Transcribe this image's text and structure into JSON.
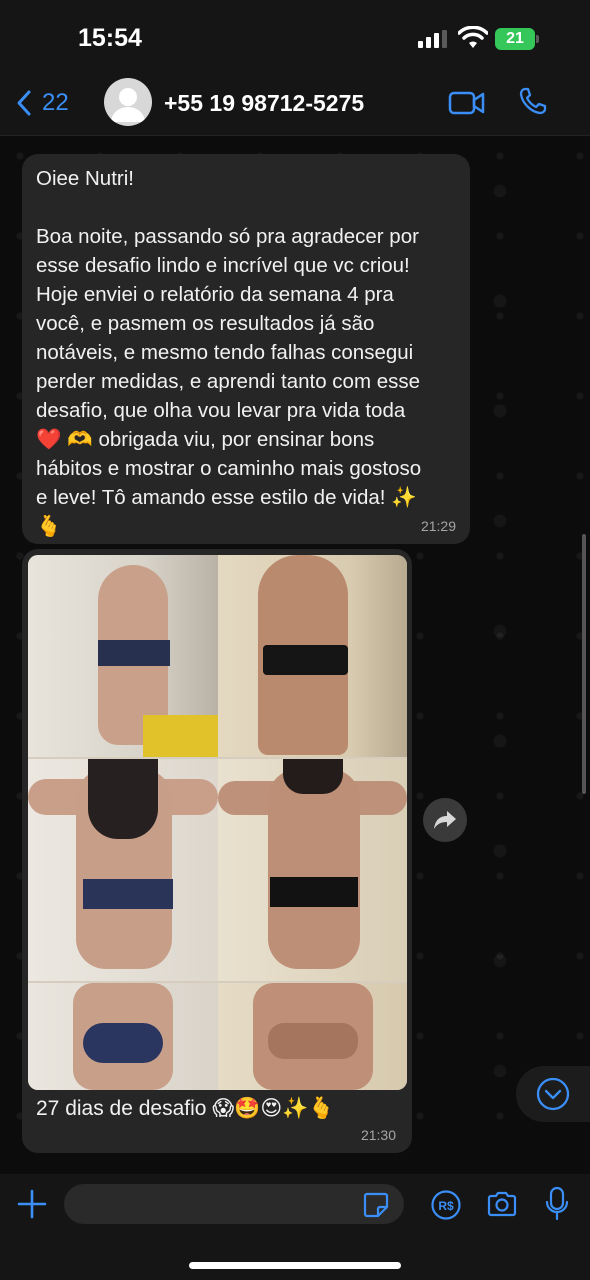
{
  "status_bar": {
    "time": "15:54",
    "battery": "21"
  },
  "header": {
    "back_count": "22",
    "contact": "+55 19 98712-5275",
    "icons": [
      "chevron-left-icon",
      "avatar",
      "video-icon",
      "phone-icon"
    ],
    "accent_color": "#3a8ef6"
  },
  "messages": [
    {
      "lines": [
        "Oiee Nutri!",
        "",
        "Boa noite, passando só pra agradecer por",
        "esse desafio lindo e incrível que vc criou!",
        "Hoje enviei o relatório da semana 4 pra",
        "você, e pasmem os resultados já são",
        "notáveis, e mesmo tendo falhas consegui",
        "perder medidas, e aprendi tanto com esse",
        "desafio, que olha vou levar pra vida toda",
        "❤️ 🫶 obrigada viu, por ensinar bons",
        "hábitos e mostrar o caminho mais gostoso",
        "e leve! Tô amando esse estilo de vida! ✨",
        "🫰"
      ],
      "time": "21:29"
    },
    {
      "caption": "27 dias de desafio 😱🤩😍✨🫰",
      "time": "21:30"
    }
  ],
  "input": {
    "placeholder": ""
  },
  "colors": {
    "bubble": "#262626",
    "background": "#0c0c0c",
    "bars": "#151515",
    "battery": "#35c759"
  }
}
